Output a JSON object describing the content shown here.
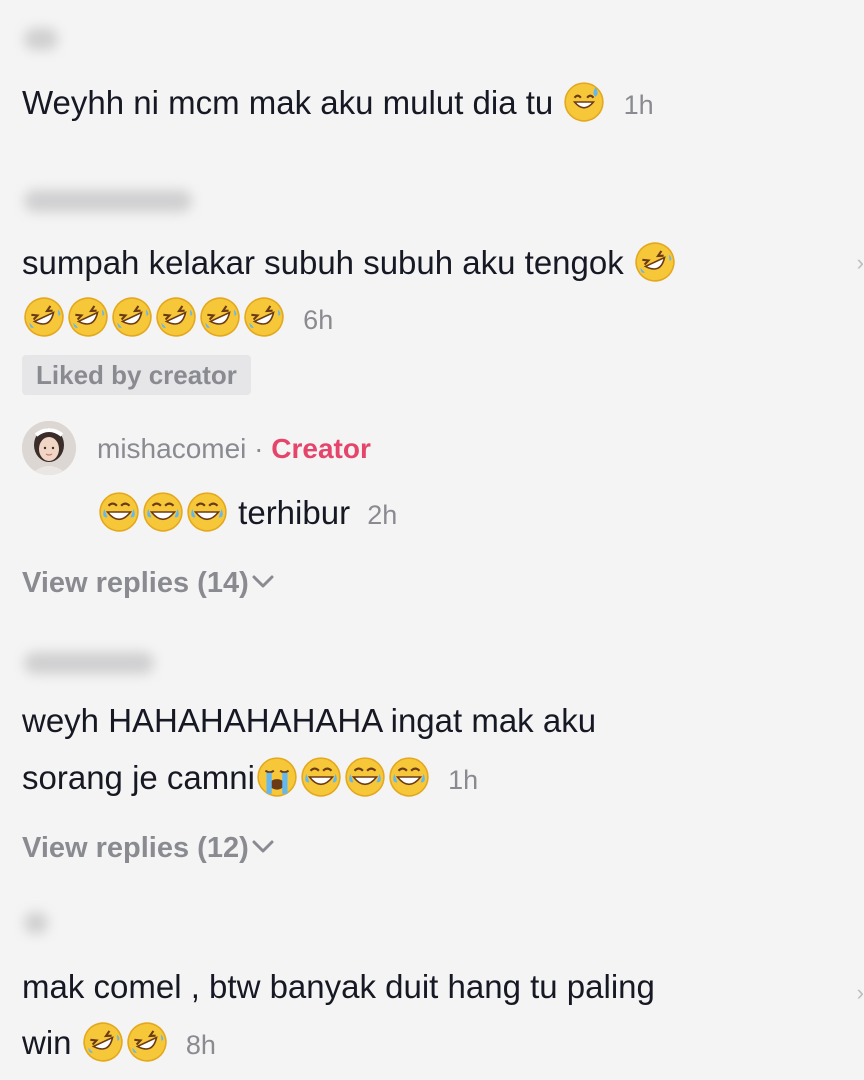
{
  "comments": [
    {
      "text": "Weyhh ni mcm mak aku mulut dia tu",
      "emojis": [
        "sweat-smile"
      ],
      "time": "1h"
    },
    {
      "line1": "sumpah kelakar subuh subuh aku tengok",
      "line1_emojis": [
        "rofl"
      ],
      "line2_emojis": [
        "rofl",
        "rofl",
        "rofl",
        "rofl",
        "rofl",
        "rofl"
      ],
      "time": "6h",
      "liked_badge": "Liked by creator",
      "reply": {
        "username": "mishacomei",
        "separator": "·",
        "tag": "Creator",
        "emojis": [
          "joy",
          "joy",
          "joy"
        ],
        "text": "terhibur",
        "time": "2h"
      },
      "view_replies": "View replies (14)"
    },
    {
      "line1": "weyh HAHAHAHAHAHA ingat mak aku",
      "line2": "sorang je camni",
      "line2_emojis": [
        "sob",
        "joy",
        "joy",
        "joy"
      ],
      "time": "1h",
      "view_replies": "View replies (12)"
    },
    {
      "line1": "mak comel , btw banyak duit hang tu paling",
      "line2": "win",
      "line2_emojis": [
        "rofl",
        "rofl"
      ],
      "time": "8h"
    }
  ],
  "colors": {
    "background": "#f4f4f4",
    "text": "#161823",
    "muted": "#8a8b91",
    "creator": "#e6456b",
    "badge_bg": "#e6e6e8"
  }
}
